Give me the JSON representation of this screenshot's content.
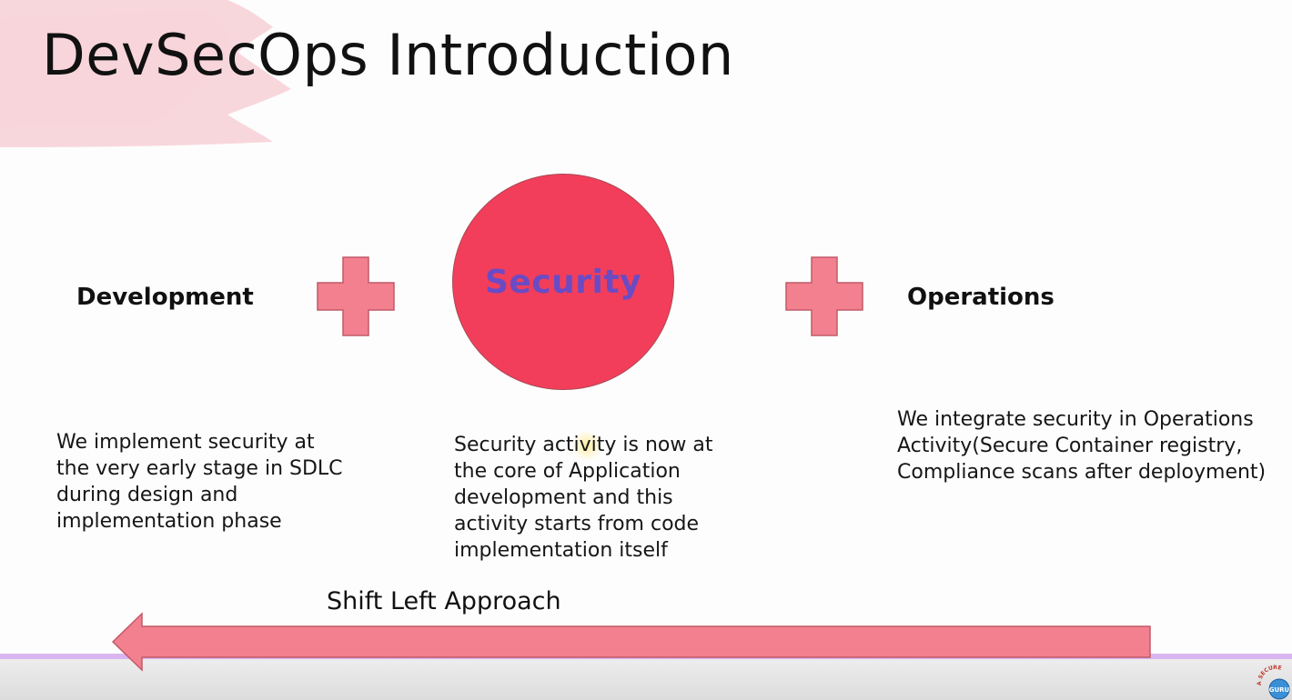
{
  "slide": {
    "title": "DevSecOps Introduction",
    "development": {
      "heading": "Development",
      "description": "We implement security at the very early stage in SDLC during design and implementation phase"
    },
    "security": {
      "label": "Security",
      "description": "Security activity is now at the core of Application development and this activity starts from code implementation itself"
    },
    "operations": {
      "heading": "Operations",
      "description": "We integrate security in Operations Activity(Secure Container registry, Compliance scans after deployment)"
    },
    "shift_label": "Shift Left Approach"
  },
  "logo": {
    "arc_text": "A SECURE",
    "badge_text": "GURU"
  },
  "colors": {
    "circle_fill": "#f23e5a",
    "security_text": "#6a4bc4",
    "plus_fill": "#f3808f",
    "arrow_fill": "#f3808f",
    "brush": "#f6c9d0",
    "bottom_line": "#d9b6ef"
  }
}
